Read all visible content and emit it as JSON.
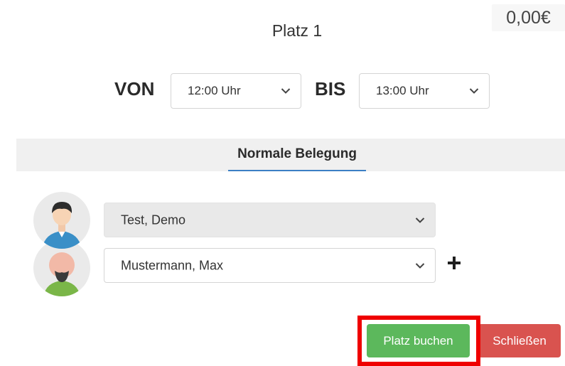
{
  "price": "0,00€",
  "title": "Platz 1",
  "time": {
    "from_label": "VON",
    "from_value": "12:00 Uhr",
    "to_label": "BIS",
    "to_value": "13:00 Uhr"
  },
  "tab": {
    "label": "Normale Belegung"
  },
  "players": [
    {
      "name": "Test, Demo"
    },
    {
      "name": "Mustermann, Max"
    }
  ],
  "actions": {
    "book_label": "Platz buchen",
    "close_label": "Schließen"
  },
  "colors": {
    "book": "#5cb85c",
    "close": "#d9534f",
    "highlight": "#ef0000",
    "tab_underline": "#3b7fc4"
  },
  "icons": {
    "chevron": "chevron-down-icon",
    "add": "plus-icon",
    "avatar": "user-avatar-icon"
  }
}
